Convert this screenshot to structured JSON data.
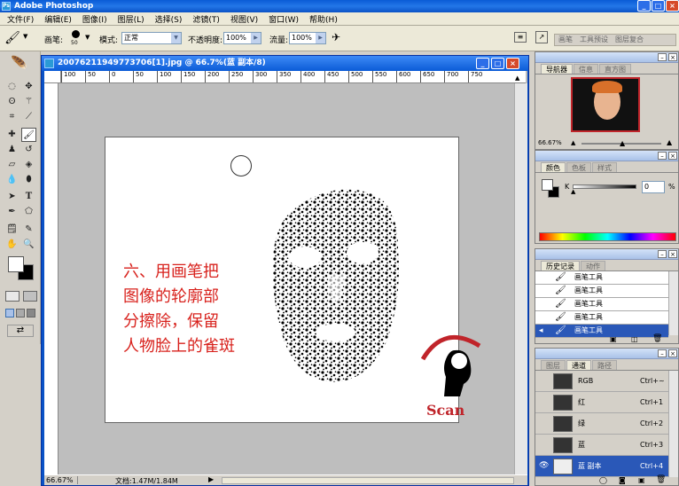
{
  "app": {
    "title": "Adobe Photoshop",
    "logo": "Ps"
  },
  "menu": [
    "文件(F)",
    "编辑(E)",
    "图像(I)",
    "图层(L)",
    "选择(S)",
    "滤镜(T)",
    "视图(V)",
    "窗口(W)",
    "帮助(H)"
  ],
  "options": {
    "brush_label": "画笔:",
    "brush_size": "50",
    "mode_label": "模式:",
    "mode_value": "正常",
    "opacity_label": "不透明度:",
    "opacity_value": "100%",
    "flow_label": "流量:",
    "flow_value": "100%",
    "well_tabs": [
      "画笔",
      "工具预设",
      "图层复合"
    ]
  },
  "document": {
    "title": "20076211949773706[1].jpg @ 66.7%(蓝 副本/8)",
    "ruler_ticks": [
      "100",
      "50",
      "0",
      "50",
      "100",
      "150",
      "200",
      "250",
      "300",
      "350",
      "400",
      "450",
      "500",
      "550",
      "600",
      "650",
      "700",
      "750"
    ],
    "annotation_lines": [
      "六、用画笔把",
      "图像的轮廓部",
      "分擦除，保留",
      "人物脸上的雀斑"
    ],
    "logo_text": "Scan",
    "zoom": "66.67%",
    "doc_info": "文档:1.47M/1.84M"
  },
  "navigator": {
    "tabs": [
      "导航器",
      "信息",
      "直方图"
    ],
    "zoom": "66.67%"
  },
  "color": {
    "tabs": [
      "颜色",
      "色板",
      "样式"
    ],
    "channel_label": "K",
    "value": "0",
    "unit": "%"
  },
  "history": {
    "tabs": [
      "历史记录",
      "动作"
    ],
    "items": [
      "画笔工具",
      "画笔工具",
      "画笔工具",
      "画笔工具",
      "画笔工具"
    ]
  },
  "channels": {
    "tabs": [
      "图层",
      "通道",
      "路径"
    ],
    "rows": [
      {
        "name": "RGB",
        "shortcut": "Ctrl+~"
      },
      {
        "name": "红",
        "shortcut": "Ctrl+1"
      },
      {
        "name": "绿",
        "shortcut": "Ctrl+2"
      },
      {
        "name": "蓝",
        "shortcut": "Ctrl+3"
      },
      {
        "name": "蓝 副本",
        "shortcut": "Ctrl+4"
      }
    ]
  },
  "colors": {
    "annotation_red": "#d8221d",
    "selection_blue": "#2a58b8",
    "title_blue": "#0a5bd6"
  }
}
